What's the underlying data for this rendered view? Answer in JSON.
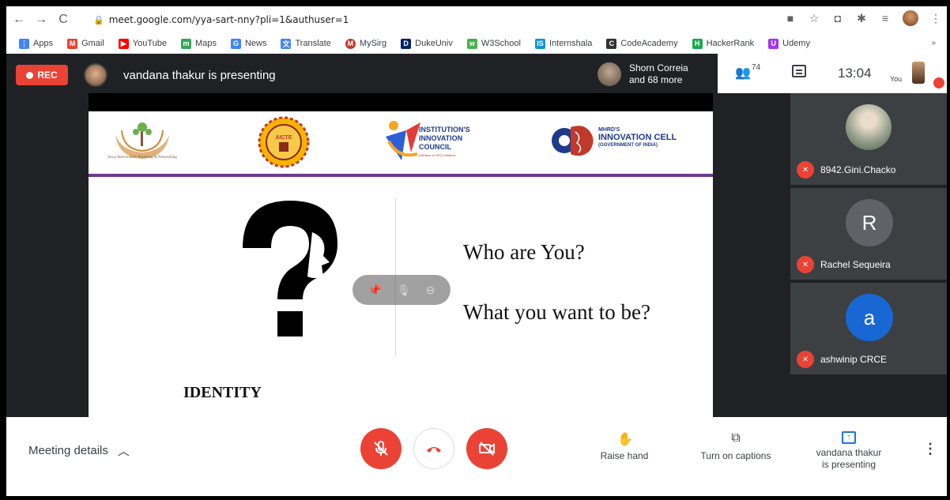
{
  "browser": {
    "url": "meet.google.com/yya-sart-nny?pli=1&authuser=1",
    "bookmarks": [
      {
        "label": "Apps",
        "icon": "apps-grid-icon",
        "color": "#4285f4"
      },
      {
        "label": "Gmail",
        "icon": "gmail-icon",
        "color": "#ea4335"
      },
      {
        "label": "YouTube",
        "icon": "youtube-icon",
        "color": "#ff0000"
      },
      {
        "label": "Maps",
        "icon": "maps-icon",
        "color": "#34a853"
      },
      {
        "label": "News",
        "icon": "news-icon",
        "color": "#4285f4"
      },
      {
        "label": "Translate",
        "icon": "translate-icon",
        "color": "#4285f4"
      },
      {
        "label": "MySirg",
        "icon": "mysirg-icon",
        "color": "#c0392b"
      },
      {
        "label": "DukeUniv",
        "icon": "duke-icon",
        "color": "#012169"
      },
      {
        "label": "W3School",
        "icon": "w3school-icon",
        "color": "#4caf50"
      },
      {
        "label": "Internshala",
        "icon": "internshala-icon",
        "color": "#1295d8"
      },
      {
        "label": "CodeAcademy",
        "icon": "codeacademy-icon",
        "color": "#333333"
      },
      {
        "label": "HackerRank",
        "icon": "hackerrank-icon",
        "color": "#1ba94c"
      },
      {
        "label": "Udemy",
        "icon": "udemy-icon",
        "color": "#a435f0"
      }
    ],
    "more": "»"
  },
  "meet": {
    "rec_label": "REC",
    "presenting_text": "vandana thakur is presenting",
    "participants_chip": {
      "line1": "Shorn Correia",
      "line2": "and 68 more"
    },
    "people_count": "74",
    "clock": "13:04",
    "you_label": "You"
  },
  "slide": {
    "logo1_caption": "Sewa Intervention Nurturing & Networking",
    "logo2_text": "AICTE",
    "logo3_lines": [
      "INSTITUTION'S",
      "INNOVATION",
      "COUNCIL"
    ],
    "logo3_sub": "(Ministry of HRD Initiative)",
    "logo4_small": "MHRD'S",
    "logo4_big": "INNOVATION CELL",
    "logo4_gov": "(GOVERNMENT OF INDIA)",
    "question1": "Who are You?",
    "question2": "What  you want to be?",
    "footer": "IDENTITY"
  },
  "tiles": [
    {
      "name": "8942.Gini.Chacko",
      "type": "photo"
    },
    {
      "name": "Rachel Sequeira",
      "initial": "R",
      "color": "#3c4043"
    },
    {
      "name": "ashwinip CRCE",
      "initial": "a",
      "color": "#1967d2"
    }
  ],
  "bottom": {
    "meeting_details": "Meeting details",
    "raise_hand": "Raise hand",
    "captions": "Turn on captions",
    "present_line1": "vandana thakur",
    "present_line2": "is presenting"
  },
  "colors": {
    "accent_red": "#ea4335",
    "meet_bg": "#202124",
    "slide_rule": "#6a3b8d",
    "tile_bg": "#3c4043"
  }
}
